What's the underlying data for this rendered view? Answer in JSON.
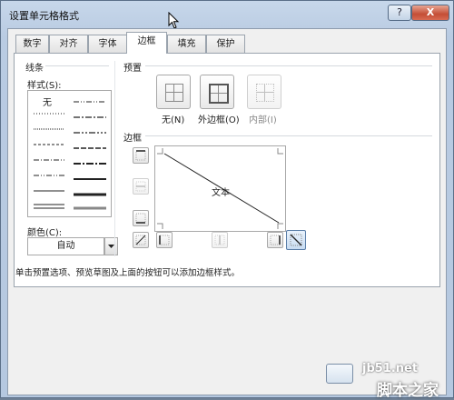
{
  "dialog": {
    "title": "设置单元格格式",
    "help_label": "?",
    "close_label": "X"
  },
  "tabs": [
    {
      "label": "数字"
    },
    {
      "label": "对齐"
    },
    {
      "label": "字体"
    },
    {
      "label": "边框",
      "active": true
    },
    {
      "label": "填充"
    },
    {
      "label": "保护"
    }
  ],
  "line_group": {
    "title": "线条",
    "style_label": "样式(S):",
    "none_label": "无",
    "color_label": "颜色(C):",
    "color_value": "自动"
  },
  "presets": {
    "title": "预置",
    "none_label": "无(N)",
    "outline_label": "外边框(O)",
    "inside_label": "内部(I)"
  },
  "border": {
    "title": "边框",
    "preview_text": "文本"
  },
  "hint_text": "单击预置选项、预览草图及上面的按钮可以添加边框样式。",
  "watermark": {
    "site": "jb51.net",
    "brand": "脚本之家"
  },
  "colors": {
    "highlight": "#e0151f",
    "title_bar": "#c7d7ea",
    "close_button": "#c44e36"
  }
}
